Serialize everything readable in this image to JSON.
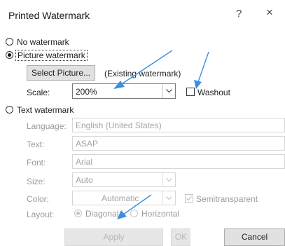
{
  "dialog": {
    "title": "Printed Watermark",
    "help": "?",
    "close": "×"
  },
  "options": {
    "no_watermark": "No watermark",
    "picture_watermark": "Picture watermark",
    "text_watermark": "Text watermark"
  },
  "picture": {
    "select_button": "Select Picture...",
    "existing": "(Existing watermark)",
    "scale_label": "Scale:",
    "scale_value": "200%",
    "washout_label": "Washout"
  },
  "text": {
    "language_label": "Language:",
    "language_value": "English (United States)",
    "text_label": "Text:",
    "text_value": "ASAP",
    "font_label": "Font:",
    "font_value": "Arial",
    "size_label": "Size:",
    "size_value": "Auto",
    "color_label": "Color:",
    "color_value": "Automatic",
    "semitransparent_label": "Semitransparent",
    "layout_label": "Layout:",
    "layout_diagonal": "Diagonal",
    "layout_horizontal": "Horizontal"
  },
  "buttons": {
    "apply": "Apply",
    "ok": "OK",
    "cancel": "Cancel"
  },
  "colors": {
    "annotation_arrow": "#3c8fe0",
    "disabled_text": "#9a9a9a"
  }
}
